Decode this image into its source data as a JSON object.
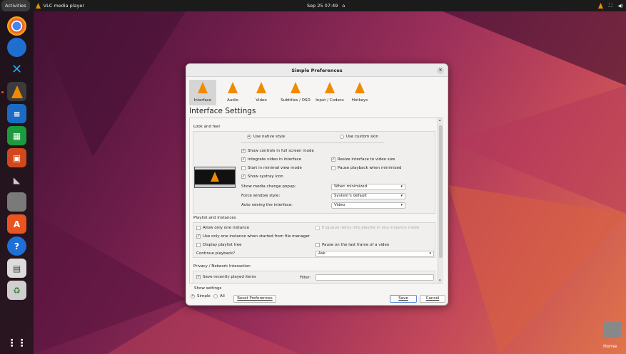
{
  "topbar": {
    "activities": "Activities",
    "app_name": "VLC media player",
    "clock": "Sep 25  07:49"
  },
  "desktop": {
    "home_label": "Home"
  },
  "dialog": {
    "title": "Simple Preferences",
    "categories": [
      {
        "label": "Interface"
      },
      {
        "label": "Audio"
      },
      {
        "label": "Video"
      },
      {
        "label": "Subtitles / OSD"
      },
      {
        "label": "Input / Codecs"
      },
      {
        "label": "Hotkeys"
      }
    ],
    "section_title": "Interface Settings",
    "look_and_feel": {
      "label": "Look and feel",
      "use_native_style": "Use native style",
      "use_custom_skin": "Use custom skin",
      "show_controls_fullscreen": "Show controls in full screen mode",
      "integrate_video": "Integrate video in interface",
      "resize_interface": "Resize interface to video size",
      "start_minimal": "Start in minimal view mode",
      "pause_minimized": "Pause playback when minimized",
      "show_systray": "Show systray icon",
      "media_change_popup_label": "Show media change popup:",
      "media_change_popup_value": "When minimized",
      "force_window_style_label": "Force window style:",
      "force_window_style_value": "System's default",
      "auto_raising_label": "Auto raising the interface:",
      "auto_raising_value": "Video"
    },
    "playlist": {
      "label": "Playlist and Instances",
      "allow_one_instance": "Allow only one instance",
      "enqueue_items": "Enqueue items into playlist in one instance mode",
      "one_instance_file_manager": "Use only one instance when started from file manager",
      "display_playlist_tree": "Display playlist tree",
      "pause_last_frame": "Pause on the last frame of a video",
      "continue_playback_label": "Continue playback?",
      "continue_playback_value": "Ask"
    },
    "privacy": {
      "label": "Privacy / Network Interaction",
      "save_recent": "Save recently played items",
      "filter_label": "Filter:"
    },
    "show_settings": {
      "label": "Show settings",
      "simple": "Simple",
      "all": "All"
    },
    "buttons": {
      "reset": "Reset Preferences",
      "save": "Save",
      "cancel": "Cancel"
    }
  }
}
